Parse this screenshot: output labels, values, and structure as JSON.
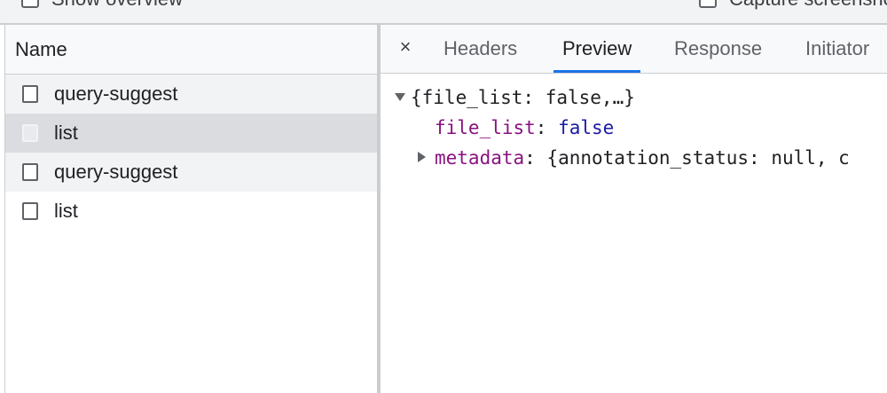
{
  "top_options": {
    "show_overview": "Show overview",
    "capture_screenshots": "Capture screenshots"
  },
  "request_list": {
    "column_header": "Name",
    "rows": [
      {
        "name": "query-suggest",
        "state": "alt"
      },
      {
        "name": "list",
        "state": "selected"
      },
      {
        "name": "query-suggest",
        "state": "alt"
      },
      {
        "name": "list",
        "state": "normal"
      }
    ]
  },
  "detail_tabs": {
    "close_glyph": "×",
    "items": [
      "Headers",
      "Preview",
      "Response",
      "Initiator"
    ],
    "active": "Preview"
  },
  "preview": {
    "root_summary": "{file_list: false,…}",
    "prop1_key": "file_list",
    "prop1_sep": ": ",
    "prop1_value": "false",
    "prop2_key": "metadata",
    "prop2_sep": ": ",
    "prop2_value": "{annotation_status: null, c"
  },
  "colors": {
    "accent": "#1a73e8",
    "selected_row": "#dadce0",
    "alt_row": "#f1f3f4",
    "json_key": "#881280",
    "json_bool": "#1a1aa6"
  }
}
